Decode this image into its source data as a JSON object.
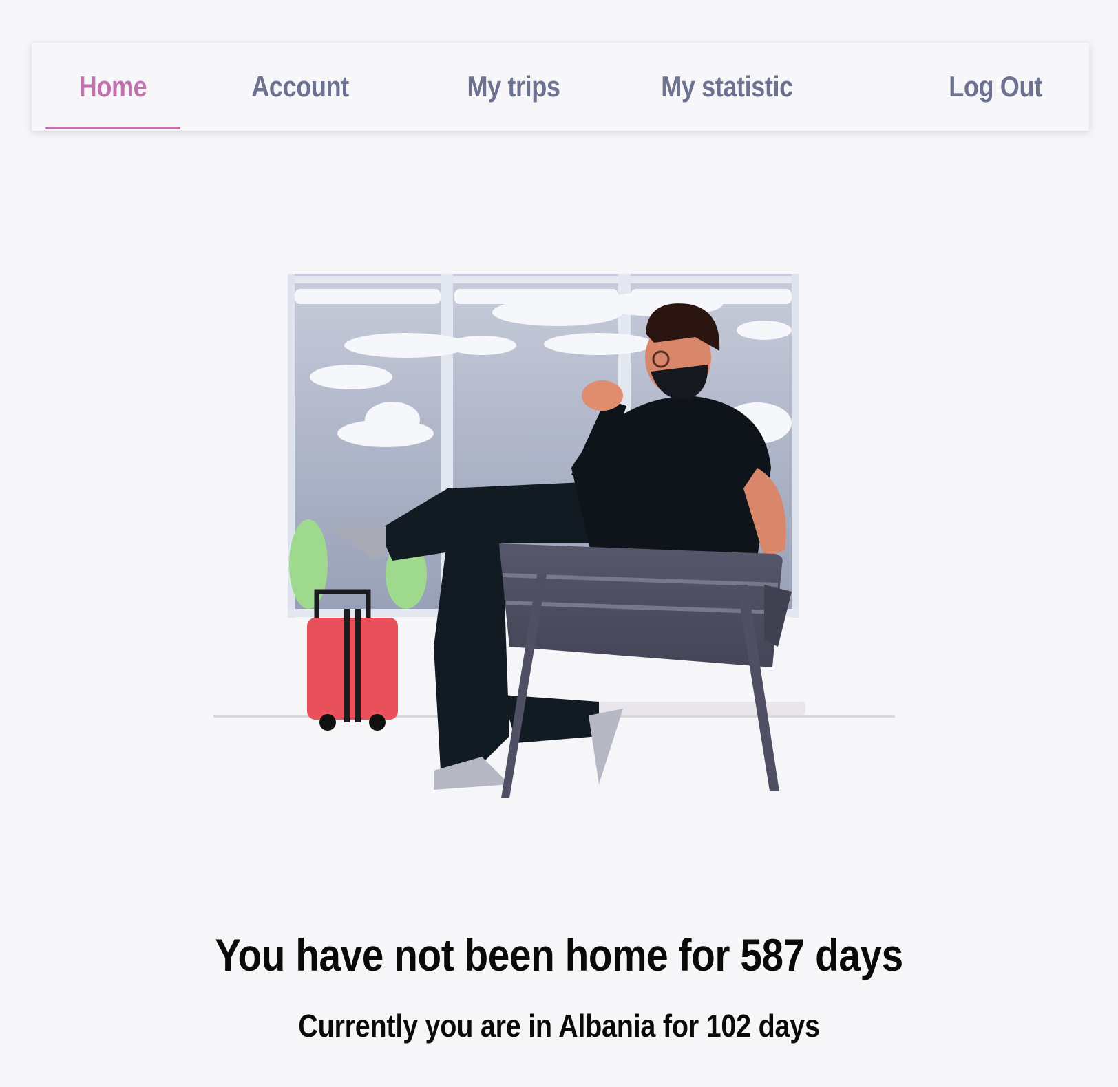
{
  "nav": {
    "home_label": "Home",
    "account_label": "Account",
    "trips_label": "My trips",
    "statistic_label": "My statistic",
    "logout_label": "Log Out",
    "active_tab": "Home",
    "active_color": "#c173ad",
    "inactive_color": "#6d7290"
  },
  "illustration": {
    "icon": "traveler-waiting-at-airport-illustration",
    "suitcase_color": "#e8505b"
  },
  "status": {
    "away_message": "You have not been home for 587 days",
    "current_message": "Currently you are in Albania for 102 days"
  }
}
